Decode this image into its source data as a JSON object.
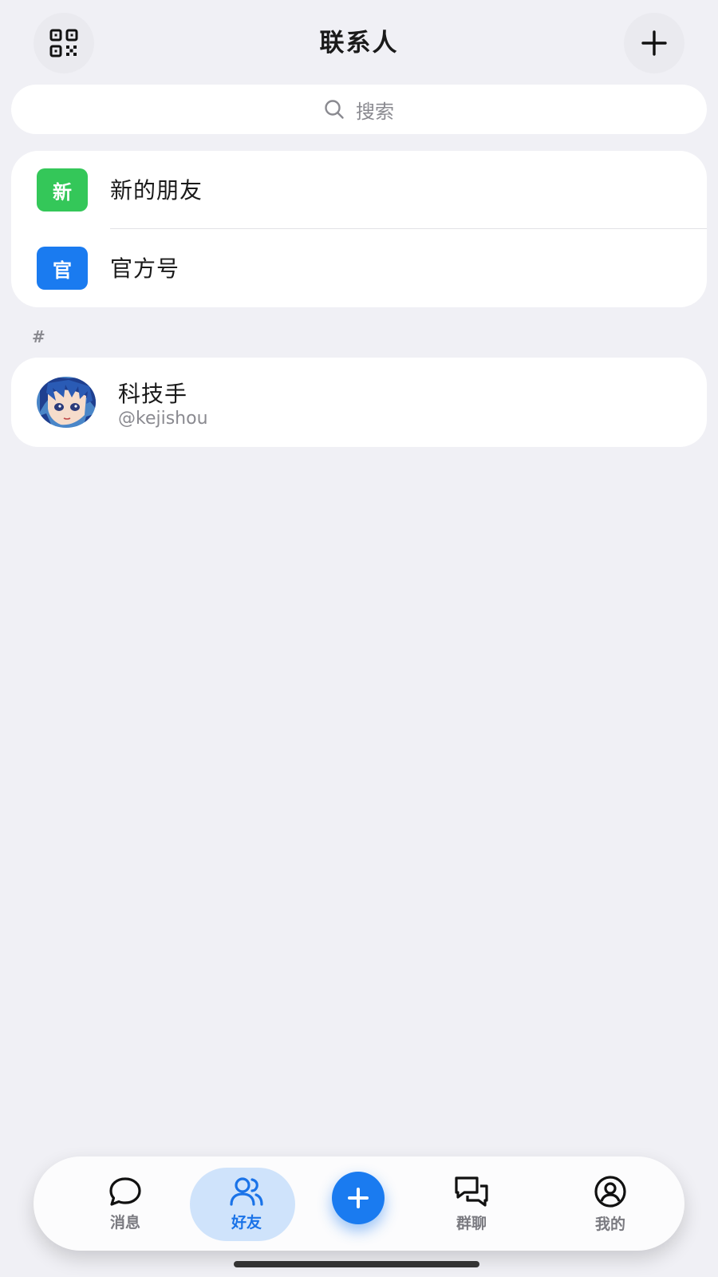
{
  "header": {
    "title": "联系人",
    "left_icon": "qr-code-icon",
    "right_icon": "plus-icon"
  },
  "search": {
    "placeholder": "搜索",
    "icon": "search-icon"
  },
  "entries": [
    {
      "badge": "新",
      "label": "新的朋友",
      "badge_color": "#34c759"
    },
    {
      "badge": "官",
      "label": "官方号",
      "badge_color": "#1a7bf0"
    }
  ],
  "section": {
    "letter": "#"
  },
  "contacts": [
    {
      "name": "科技手",
      "handle": "@kejishou",
      "avatar": "anime-avatar"
    }
  ],
  "tabbar": {
    "items": [
      {
        "label": "消息",
        "icon": "chat-bubble-icon"
      },
      {
        "label": "好友",
        "icon": "friends-icon",
        "active": true
      },
      {
        "label": "群聊",
        "icon": "group-chat-icon"
      },
      {
        "label": "我的",
        "icon": "profile-icon"
      }
    ],
    "fab_icon": "plus-icon"
  },
  "colors": {
    "accent": "#1a7bf0",
    "active_tab_bg": "#cfe3fb",
    "new_badge": "#34c759",
    "official_badge": "#1a7bf0",
    "background": "#f0f0f5"
  }
}
